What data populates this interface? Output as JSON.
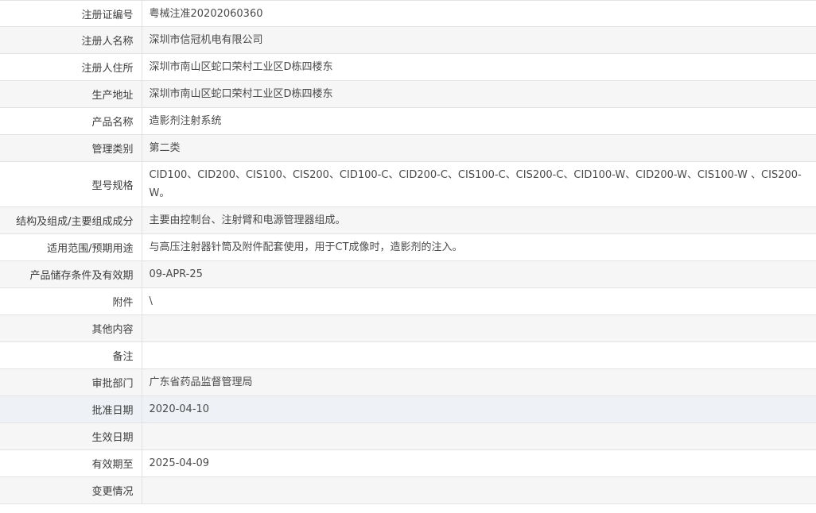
{
  "rows": [
    {
      "label": "注册证编号",
      "value": "粤械注准20202060360"
    },
    {
      "label": "注册人名称",
      "value": "深圳市信冠机电有限公司"
    },
    {
      "label": "注册人住所",
      "value": "深圳市南山区蛇口荣村工业区D栋四楼东"
    },
    {
      "label": "生产地址",
      "value": "深圳市南山区蛇口荣村工业区D栋四楼东"
    },
    {
      "label": "产品名称",
      "value": "造影剂注射系统"
    },
    {
      "label": "管理类别",
      "value": "第二类"
    },
    {
      "label": "型号规格",
      "value": "CID100、CID200、CIS100、CIS200、CID100-C、CID200-C、CIS100-C、CIS200-C、CID100-W、CID200-W、CIS100-W 、CIS200-W。"
    },
    {
      "label": "结构及组成/主要组成成分",
      "value": "主要由控制台、注射臂和电源管理器组成。"
    },
    {
      "label": "适用范围/预期用途",
      "value": "与高压注射器针筒及附件配套使用，用于CT成像时，造影剂的注入。"
    },
    {
      "label": "产品储存条件及有效期",
      "value": "09-APR-25"
    },
    {
      "label": "附件",
      "value": "\\"
    },
    {
      "label": "其他内容",
      "value": ""
    },
    {
      "label": "备注",
      "value": ""
    },
    {
      "label": "审批部门",
      "value": "广东省药品监督管理局"
    },
    {
      "label": "批准日期",
      "value": "2020-04-10"
    },
    {
      "label": "生效日期",
      "value": ""
    },
    {
      "label": "有效期至",
      "value": "2025-04-09"
    },
    {
      "label": "变更情况",
      "value": ""
    }
  ]
}
